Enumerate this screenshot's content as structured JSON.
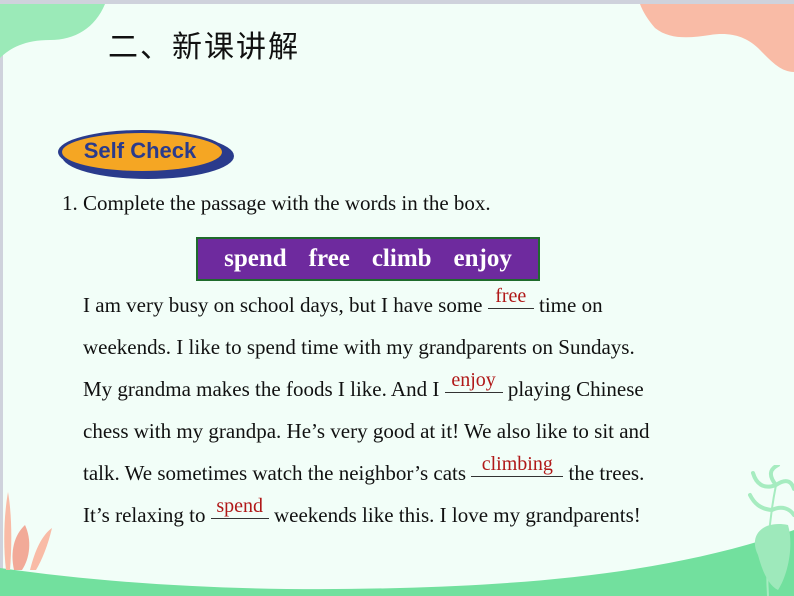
{
  "slide": {
    "title": "二、新课讲解",
    "badge": "Self Check",
    "instruction": "1. Complete the passage with the words in the box.",
    "word_box": [
      "spend",
      "free",
      "climb",
      "enjoy"
    ],
    "passage": [
      {
        "before": "I am very busy on school days, but I have some ",
        "answer": "free",
        "after": " time on"
      },
      {
        "text": "weekends. I like to spend time with my grandparents on Sundays."
      },
      {
        "before": "My grandma makes the foods I like. And I ",
        "answer": "enjoy",
        "after": " playing Chinese"
      },
      {
        "text": "chess with my grandpa. He’s very good at it! We also like to sit and"
      },
      {
        "before": "talk. We sometimes watch the neighbor’s cats ",
        "answer": "climbing",
        "after": " the trees."
      },
      {
        "before": "It’s relaxing to ",
        "answer": "spend",
        "after": " weekends like this. I love my grandparents!"
      }
    ]
  },
  "colors": {
    "background": "#f2fef8",
    "answer": "#b01818",
    "word_box_bg": "#6e2a9e",
    "word_box_border": "#1f6b2c",
    "badge_fill": "#f5a623",
    "badge_text": "#2a3b8c",
    "green_accent": "#72e09e",
    "peach_accent": "#f9bba6"
  }
}
